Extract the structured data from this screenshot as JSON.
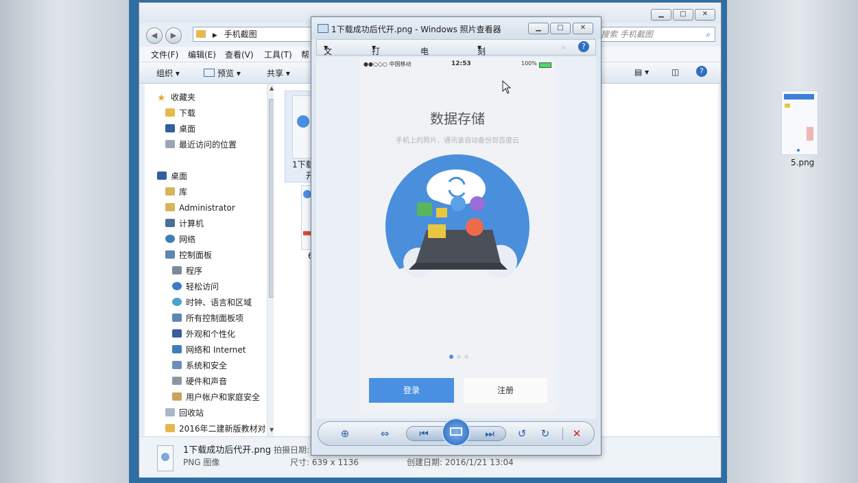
{
  "explorer": {
    "address": "手机截图",
    "search_placeholder": "搜索 手机截图",
    "menu": [
      "文件(F)",
      "编辑(E)",
      "查看(V)",
      "工具(T)",
      "帮"
    ],
    "toolbar": {
      "organize": "组织",
      "preview": "预览",
      "share": "共享"
    },
    "nav": [
      {
        "label": "收藏夹"
      },
      {
        "label": "下载"
      },
      {
        "label": "桌面"
      },
      {
        "label": "最近访问的位置"
      },
      {
        "label": "桌面"
      },
      {
        "label": "库"
      },
      {
        "label": "Administrator"
      },
      {
        "label": "计算机"
      },
      {
        "label": "网络"
      },
      {
        "label": "控制面板"
      },
      {
        "label": "程序"
      },
      {
        "label": "轻松访问"
      },
      {
        "label": "时钟、语言和区域"
      },
      {
        "label": "所有控制面板项"
      },
      {
        "label": "外观和个性化"
      },
      {
        "label": "网络和 Internet"
      },
      {
        "label": "系统和安全"
      },
      {
        "label": "硬件和声音"
      },
      {
        "label": "用户帐户和家庭安全"
      },
      {
        "label": "回收站"
      },
      {
        "label": "2016年二建新版教材对"
      }
    ],
    "files": [
      {
        "label_line1": "1下载",
        "label_line2": "开"
      },
      {
        "label": "6"
      },
      {
        "label": "5.png"
      }
    ],
    "details": {
      "filename": "1下载成功后代开.png",
      "date_taken_label": "拍摄日期:",
      "type": "PNG 图像",
      "size_label": "尺寸: 639 x 1136",
      "created_label": "创建日期: 2016/1/21 13:04"
    }
  },
  "viewer": {
    "title": "1下载成功后代开.png - Windows 照片查看器",
    "menu": [
      "文件(F)",
      "打印(P)",
      "电子邮件(E)",
      "刻录(U)"
    ],
    "phone": {
      "carrier": "●●○○○ 中国移动",
      "time": "12:53",
      "battery": "100%",
      "heading": "数据存储",
      "subheading": "手机上的照片、通讯录自动备份到百度云",
      "login": "登录",
      "register": "注册"
    }
  },
  "colors": {
    "accent": "#4a90e2",
    "close_red": "#d02020",
    "folder": "#e8b84b"
  },
  "icons": [
    "back-icon",
    "forward-icon",
    "folder-icon",
    "search-icon",
    "help-icon",
    "star-icon",
    "cloud-sync-icon",
    "zoom-icon",
    "fit-icon",
    "prev-icon",
    "slideshow-icon",
    "next-icon",
    "rotate-left-icon",
    "rotate-right-icon",
    "delete-icon"
  ]
}
